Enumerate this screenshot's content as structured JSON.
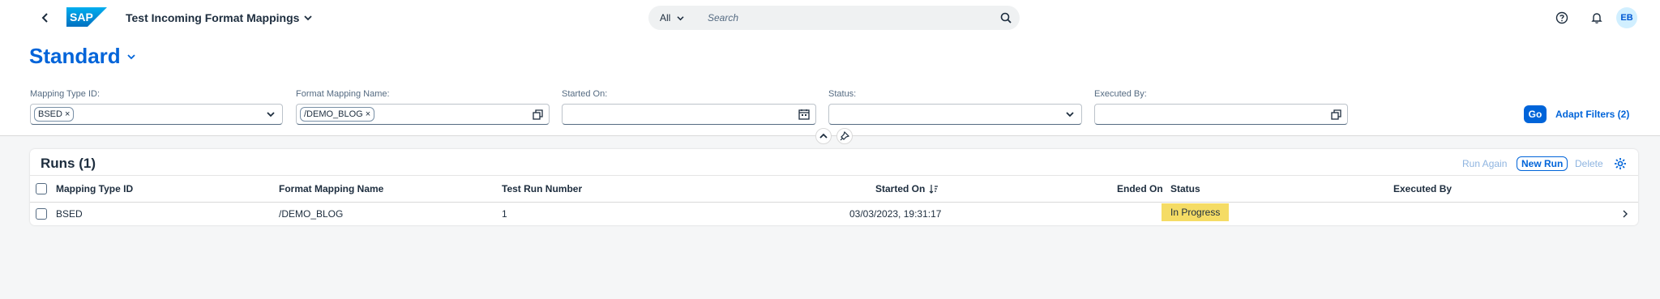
{
  "shell": {
    "app_title": "Test Incoming Format Mappings",
    "logo_text": "SAP",
    "search": {
      "scope": "All",
      "placeholder": "Search"
    },
    "avatar_initials": "EB"
  },
  "header": {
    "variant": "Standard",
    "filters": [
      {
        "label": "Mapping Type ID:",
        "tokens": [
          "BSED"
        ],
        "icon": "chevron-down-icon"
      },
      {
        "label": "Format Mapping Name:",
        "tokens": [
          "/DEMO_BLOG"
        ],
        "icon": "value-help-icon"
      },
      {
        "label": "Started On:",
        "tokens": [],
        "icon": "calendar-icon"
      },
      {
        "label": "Status:",
        "tokens": [],
        "icon": "chevron-down-icon"
      },
      {
        "label": "Executed By:",
        "tokens": [],
        "icon": "value-help-icon"
      }
    ],
    "go_label": "Go",
    "adapt_filters_label": "Adapt Filters (2)"
  },
  "table": {
    "title": "Runs (1)",
    "toolbar": {
      "run_again": "Run Again",
      "new_run": "New Run",
      "delete": "Delete"
    },
    "columns": [
      "Mapping Type ID",
      "Format Mapping Name",
      "Test Run Number",
      "Started On",
      "Ended On",
      "Status",
      "Executed By"
    ],
    "rows": [
      {
        "mapping_type_id": "BSED",
        "format_mapping_name": "/DEMO_BLOG",
        "test_run_number": "1",
        "started_on": "03/03/2023, 19:31:17",
        "ended_on": "",
        "status": "In Progress",
        "executed_by": ""
      }
    ]
  },
  "colors": {
    "brand_blue": "#0064d9",
    "status_in_progress": "#f5dc65"
  }
}
